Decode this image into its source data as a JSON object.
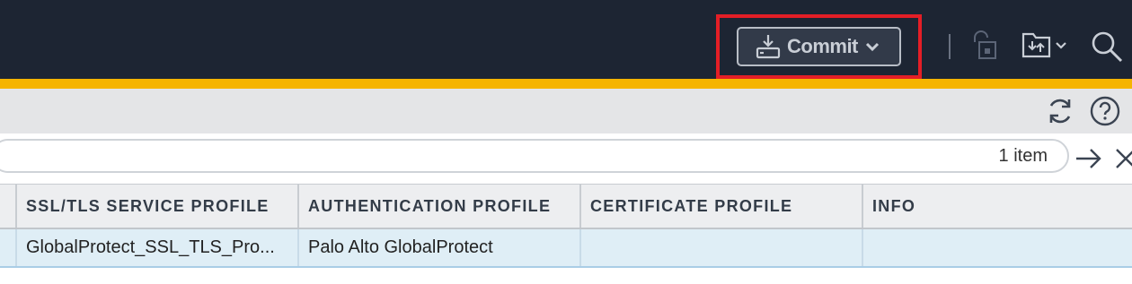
{
  "header": {
    "commit_label": "Commit"
  },
  "colors": {
    "header_bg": "#1d2533",
    "accent": "#f5b400",
    "highlight_box": "#e41e26",
    "selected_row": "#dfeef6"
  },
  "icons": [
    "commit-icon",
    "chevron-down-icon",
    "lock-icon",
    "save-config-icon",
    "search-icon",
    "refresh-icon",
    "help-icon",
    "apply-filter-icon",
    "clear-filter-icon"
  ],
  "filter": {
    "value": "",
    "count": "1 item"
  },
  "table": {
    "columns": [
      "SSL/TLS SERVICE PROFILE",
      "AUTHENTICATION PROFILE",
      "CERTIFICATE PROFILE",
      "INFO"
    ],
    "rows": [
      [
        "GlobalProtect_SSL_TLS_Pro...",
        "Palo Alto GlobalProtect",
        "",
        ""
      ]
    ]
  }
}
